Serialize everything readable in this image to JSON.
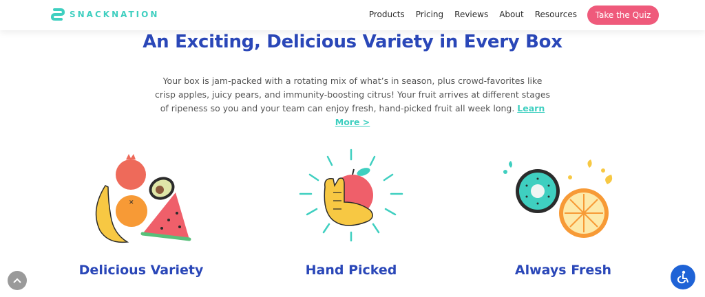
{
  "header": {
    "logo_text": "SNACKNATION",
    "nav": [
      "Products",
      "Pricing",
      "Reviews",
      "About",
      "Resources"
    ],
    "cta_label": "Take the Quiz"
  },
  "hero": {
    "title": "An Exciting, Delicious Variety in Every Box",
    "intro_text": "Your box is jam-packed with a rotating mix of what’s in season, plus crowd-favorites like crisp apples, juicy pears, and immunity-boosting citrus! Your fruit arrives at different stages of ripeness so you and your team can enjoy fresh, hand-picked fruit all week long.",
    "learn_more": "Learn More >"
  },
  "features": [
    {
      "label": "Delicious Variety",
      "icon": "fruit-assortment-icon"
    },
    {
      "label": "Hand Picked",
      "icon": "hand-holding-apple-icon"
    },
    {
      "label": "Always Fresh",
      "icon": "kiwi-orange-splash-icon"
    }
  ],
  "colors": {
    "brand_blue": "#2a47b8",
    "teal": "#3fcfc0",
    "cta_pink": "#ef5a7b",
    "accessibility_blue": "#1f63d6"
  }
}
